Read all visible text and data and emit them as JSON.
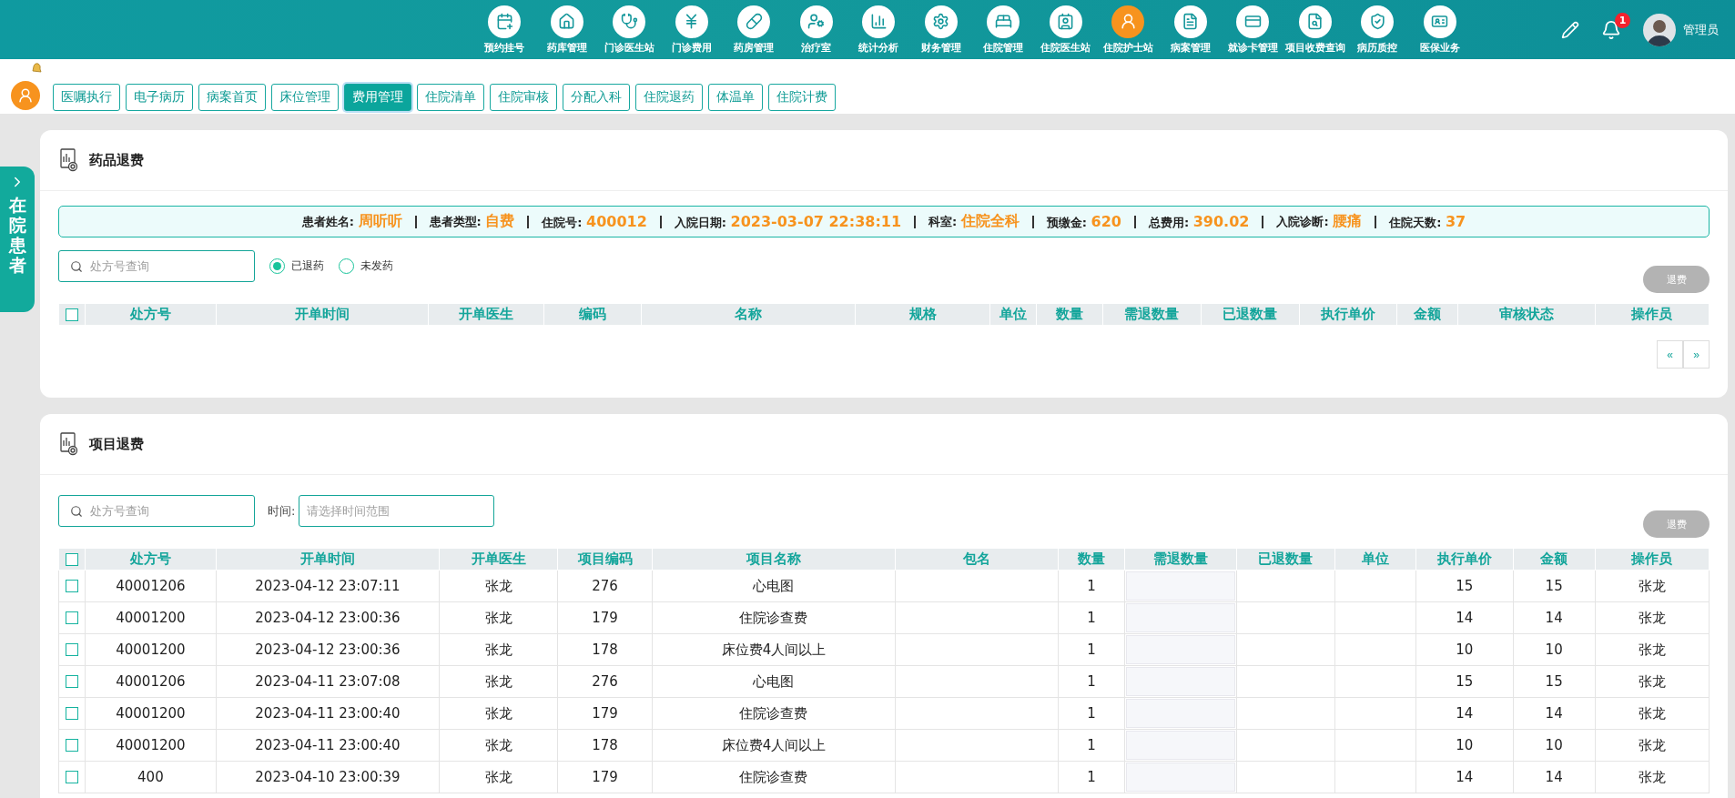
{
  "nav": {
    "items": [
      {
        "label": "预约挂号",
        "selected": false
      },
      {
        "label": "药库管理",
        "selected": false
      },
      {
        "label": "门诊医生站",
        "selected": false
      },
      {
        "label": "门诊费用",
        "selected": false
      },
      {
        "label": "药房管理",
        "selected": false
      },
      {
        "label": "治疗室",
        "selected": false
      },
      {
        "label": "统计分析",
        "selected": false
      },
      {
        "label": "财务管理",
        "selected": false
      },
      {
        "label": "住院管理",
        "selected": false
      },
      {
        "label": "住院医生站",
        "selected": false
      },
      {
        "label": "住院护士站",
        "selected": true
      },
      {
        "label": "病案管理",
        "selected": false
      },
      {
        "label": "就诊卡管理",
        "selected": false
      },
      {
        "label": "项目收费查询",
        "selected": false
      },
      {
        "label": "病历质控",
        "selected": false
      },
      {
        "label": "医保业务",
        "selected": false
      }
    ],
    "notifications": "1",
    "user": "管理员"
  },
  "tabs": [
    {
      "label": "医嘱执行",
      "selected": false
    },
    {
      "label": "电子病历",
      "selected": false
    },
    {
      "label": "病案首页",
      "selected": false
    },
    {
      "label": "床位管理",
      "selected": false
    },
    {
      "label": "费用管理",
      "selected": true
    },
    {
      "label": "住院清单",
      "selected": false
    },
    {
      "label": "住院审核",
      "selected": false
    },
    {
      "label": "分配入科",
      "selected": false
    },
    {
      "label": "住院退药",
      "selected": false
    },
    {
      "label": "体温单",
      "selected": false
    },
    {
      "label": "住院计费",
      "selected": false
    }
  ],
  "side_tab": {
    "label": "在院患者"
  },
  "drug_refund": {
    "title": "药品退费",
    "patient": [
      {
        "label": "患者姓名:",
        "value": "周听听"
      },
      {
        "label": "患者类型:",
        "value": "自费"
      },
      {
        "label": "住院号:",
        "value": "400012"
      },
      {
        "label": "入院日期:",
        "value": "2023-03-07 22:38:11"
      },
      {
        "label": "科室:",
        "value": "住院全科"
      },
      {
        "label": "预缴金:",
        "value": "620"
      },
      {
        "label": "总费用:",
        "value": "390.02"
      },
      {
        "label": "入院诊断:",
        "value": "腰痛"
      },
      {
        "label": "住院天数:",
        "value": "37"
      }
    ],
    "search": {
      "placeholder": "处方号查询"
    },
    "filters": [
      {
        "label": "已退药",
        "selected": true
      },
      {
        "label": "未发药",
        "selected": false
      }
    ],
    "refund_button": "退费",
    "table": {
      "select_all": {
        "checked": false
      },
      "columns": [
        "处方号",
        "开单时间",
        "开单医生",
        "编码",
        "名称",
        "规格",
        "单位",
        "数量",
        "需退数量",
        "已退数量",
        "执行单价",
        "金额",
        "审核状态",
        "操作员"
      ]
    },
    "pagination": [
      "«",
      "»"
    ]
  },
  "item_refund": {
    "title": "项目退费",
    "search": {
      "placeholder": "处方号查询"
    },
    "time": {
      "label": "时间:",
      "placeholder": "请选择时间范围"
    },
    "refund_button": "退费",
    "table": {
      "select_all": {
        "checked": false
      },
      "columns": [
        "处方号",
        "开单时间",
        "开单医生",
        "项目编码",
        "项目名称",
        "包名",
        "数量",
        "需退数量",
        "已退数量",
        "单位",
        "执行单价",
        "金额",
        "操作员"
      ],
      "rows": [
        {
          "checked": false,
          "cells": [
            "40001206",
            "2023-04-12 23:07:11",
            "张龙",
            "276",
            "心电图",
            "",
            "1",
            "",
            "",
            "",
            "15",
            "15",
            "张龙"
          ]
        },
        {
          "checked": false,
          "cells": [
            "40001200",
            "2023-04-12 23:00:36",
            "张龙",
            "179",
            "住院诊查费",
            "",
            "1",
            "",
            "",
            "",
            "14",
            "14",
            "张龙"
          ]
        },
        {
          "checked": false,
          "cells": [
            "40001200",
            "2023-04-12 23:00:36",
            "张龙",
            "178",
            "床位费4人间以上",
            "",
            "1",
            "",
            "",
            "",
            "10",
            "10",
            "张龙"
          ]
        },
        {
          "checked": false,
          "cells": [
            "40001206",
            "2023-04-11 23:07:08",
            "张龙",
            "276",
            "心电图",
            "",
            "1",
            "",
            "",
            "",
            "15",
            "15",
            "张龙"
          ]
        },
        {
          "checked": false,
          "cells": [
            "40001200",
            "2023-04-11 23:00:40",
            "张龙",
            "179",
            "住院诊查费",
            "",
            "1",
            "",
            "",
            "",
            "14",
            "14",
            "张龙"
          ]
        },
        {
          "checked": false,
          "cells": [
            "40001200",
            "2023-04-11 23:00:40",
            "张龙",
            "178",
            "床位费4人间以上",
            "",
            "1",
            "",
            "",
            "",
            "10",
            "10",
            "张龙"
          ]
        },
        {
          "checked": false,
          "cells": [
            "400",
            "2023-04-10 23:00:39",
            "张龙",
            "179",
            "住院诊查费",
            "",
            "1",
            "",
            "",
            "",
            "14",
            "14",
            "张龙"
          ]
        }
      ]
    }
  }
}
